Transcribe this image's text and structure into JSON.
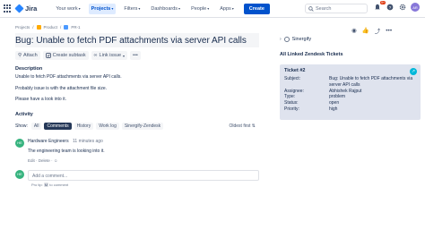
{
  "nav": {
    "logo_text": "Jira",
    "items": [
      {
        "label": "Your work"
      },
      {
        "label": "Projects"
      },
      {
        "label": "Filters"
      },
      {
        "label": "Dashboards"
      },
      {
        "label": "People"
      },
      {
        "label": "Apps"
      }
    ],
    "create_label": "Create",
    "search_placeholder": "Search",
    "notification_count": "9+",
    "avatar_initials": "AR"
  },
  "issue": {
    "breadcrumb": [
      "Projects",
      "Product",
      "PR-1"
    ],
    "title": "Bug: Unable to fetch PDF attachments via server API calls",
    "actions": [
      "Attach",
      "Create subtask",
      "Link issue"
    ],
    "description_label": "Description",
    "description": [
      "Unable to fetch PDF attachments via server API calls.",
      "Probably issue is with the attachment file size.",
      "Please have a look into it."
    ]
  },
  "activity": {
    "label": "Activity",
    "show_label": "Show:",
    "filters": [
      "All",
      "Comments",
      "History",
      "Work log",
      "Sinergify-Zendesk"
    ],
    "active_filter": "Comments",
    "sort_label": "Oldest first"
  },
  "comment": {
    "avatar": "HE",
    "author": "Hardware Engineers",
    "time": "11 minutes ago",
    "body": "The engineering team is looking into it.",
    "edit_label": "Edit",
    "separator": "·",
    "delete_label": "Delete",
    "emoji": "☺"
  },
  "add_comment": {
    "avatar": "HE",
    "placeholder": "Add a comment...",
    "protip_prefix": "Pro tip:",
    "protip_key": "M",
    "protip_suffix": "to comment"
  },
  "sidebar": {
    "app_label": "Sinergify",
    "linked_title": "All Linked Zendesk Tickets",
    "ticket_title": "Ticket #2",
    "ticket": [
      {
        "key": "Subject:",
        "value": "Bug: Unable to fetch PDF attachments via server API calls"
      },
      {
        "key": "Assignee:",
        "value": "Abhishek Rajput"
      },
      {
        "key": "Type:",
        "value": "problem"
      },
      {
        "key": "Status:",
        "value": "open"
      },
      {
        "key": "Priority:",
        "value": "high"
      }
    ]
  },
  "colors": {
    "brand": "#0052cc",
    "card": "#dfe3ee",
    "avatar": "#36b37e"
  }
}
